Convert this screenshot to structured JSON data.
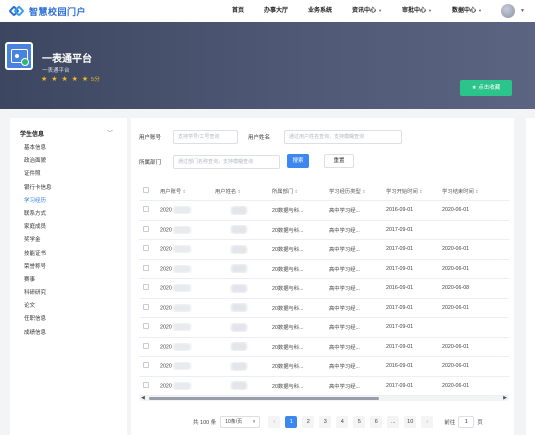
{
  "header": {
    "logo_text": "智慧校园门户",
    "nav": [
      {
        "label": "首页",
        "dropdown": false
      },
      {
        "label": "办事大厅",
        "dropdown": false
      },
      {
        "label": "业务系统",
        "dropdown": false
      },
      {
        "label": "资讯中心",
        "dropdown": true
      },
      {
        "label": "审批中心",
        "dropdown": true
      },
      {
        "label": "数据中心",
        "dropdown": true
      }
    ]
  },
  "banner": {
    "title": "一表通平台",
    "subtitle": "一表通平台",
    "stars": "★ ★ ★ ★ ★",
    "rating": "5分",
    "collect_label": "★ 点击收藏"
  },
  "sidebar": {
    "section_title": "学生信息",
    "items": [
      {
        "label": "基本信息",
        "active": false
      },
      {
        "label": "政治面貌",
        "active": false
      },
      {
        "label": "证件照",
        "active": false
      },
      {
        "label": "银行卡信息",
        "active": false
      },
      {
        "label": "学习经历",
        "active": true
      },
      {
        "label": "联系方式",
        "active": false
      },
      {
        "label": "家庭成员",
        "active": false
      },
      {
        "label": "奖学金",
        "active": false
      },
      {
        "label": "技能证书",
        "active": false
      },
      {
        "label": "荣誉称号",
        "active": false
      },
      {
        "label": "赛事",
        "active": false
      },
      {
        "label": "科研研究",
        "active": false
      },
      {
        "label": "论文",
        "active": false
      },
      {
        "label": "任职信息",
        "active": false
      },
      {
        "label": "成绩信息",
        "active": false
      }
    ]
  },
  "filters": {
    "account_label": "用户账号",
    "account_placeholder": "支持学号/工号查询",
    "name_label": "用户姓名",
    "name_placeholder": "通过用户姓名查询，支持模糊查询",
    "dept_label": "所属部门",
    "dept_placeholder": "通过部门名称查询，支持模糊查询",
    "search_label": "搜索",
    "reset_label": "重置"
  },
  "table": {
    "columns": [
      "用户账号",
      "用户姓名",
      "所属部门",
      "学习经历类型",
      "学习开始时间",
      "学习结束时间"
    ],
    "rows": [
      {
        "account": "2020",
        "dept": "20数据与科...",
        "type": "高中学习经...",
        "start": "2016-09-01",
        "end": "2020-06-01"
      },
      {
        "account": "2020",
        "dept": "20数据与科...",
        "type": "高中学习经...",
        "start": "2017-09-01",
        "end": ""
      },
      {
        "account": "2020",
        "dept": "20数据与科...",
        "type": "高中学习经...",
        "start": "2017-09-01",
        "end": "2020-06-01"
      },
      {
        "account": "2020",
        "dept": "20数据与科...",
        "type": "高中学习经...",
        "start": "2017-09-01",
        "end": "2020-06-01"
      },
      {
        "account": "2020",
        "dept": "20数据与科...",
        "type": "高中学习经...",
        "start": "2016-09-01",
        "end": "2020-06-08"
      },
      {
        "account": "2020",
        "dept": "20数据与科...",
        "type": "高中学习经...",
        "start": "2017-09-01",
        "end": "2020-06-01"
      },
      {
        "account": "2020",
        "dept": "20数据与科...",
        "type": "高中学习经...",
        "start": "2017-09-01",
        "end": ""
      },
      {
        "account": "2020",
        "dept": "20数据与科...",
        "type": "高中学习经...",
        "start": "2017-09-01",
        "end": "2020-06-01"
      },
      {
        "account": "2020",
        "dept": "20数据与科...",
        "type": "高中学习经...",
        "start": "2016-09-01",
        "end": "2020-06-01"
      },
      {
        "account": "2020",
        "dept": "20数据与科...",
        "type": "高中学习经...",
        "start": "2017-09-01",
        "end": "2020-06-01"
      }
    ]
  },
  "pagination": {
    "total_label": "共 100 条",
    "page_size": "10条/页",
    "pages": [
      "1",
      "2",
      "3",
      "4",
      "5",
      "6",
      "...",
      "10"
    ],
    "current": "1",
    "goto_label": "前往",
    "goto_value": "1",
    "page_unit": "页"
  }
}
